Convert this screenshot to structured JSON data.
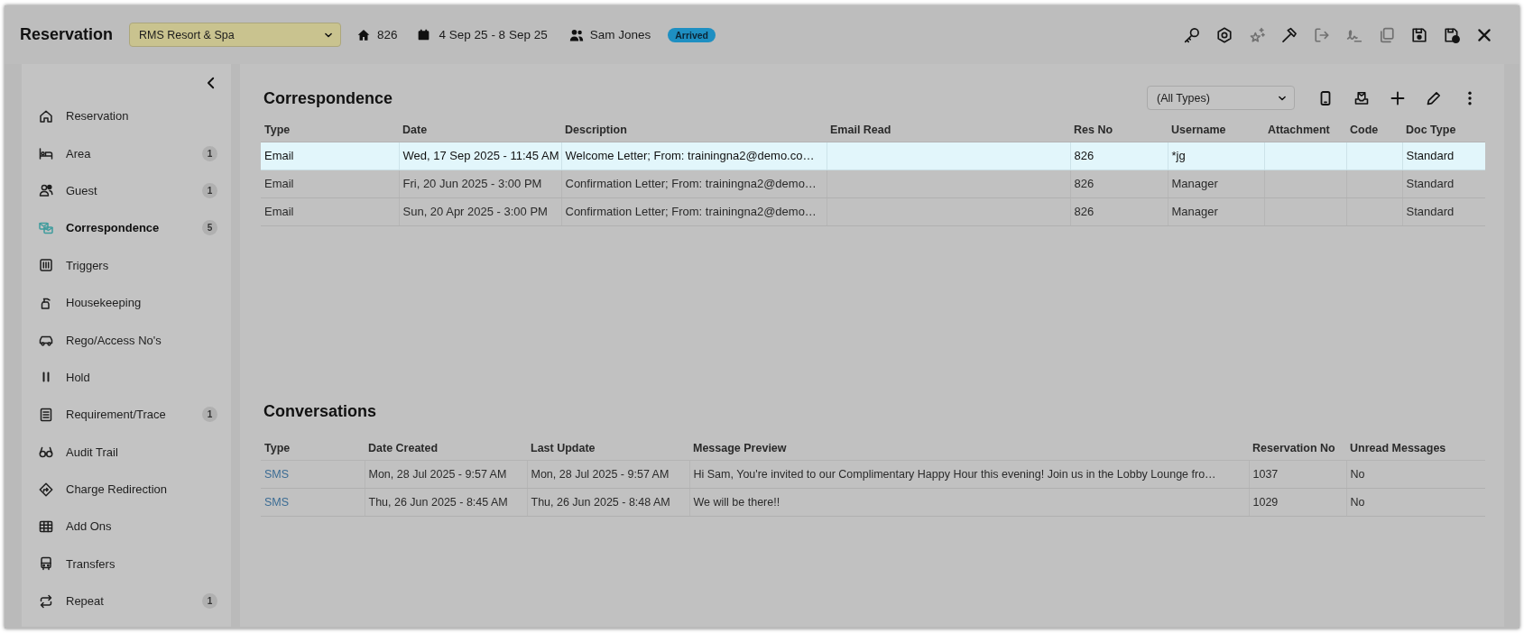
{
  "header": {
    "title": "Reservation",
    "property_select": {
      "value": "RMS Resort & Spa"
    },
    "room": "826",
    "dates": "4 Sep 25 - 8 Sep 25",
    "guest": "Sam Jones",
    "status_badge": "Arrived",
    "toolbar": [
      {
        "kind": "key",
        "disabled": false
      },
      {
        "kind": "gear",
        "disabled": false
      },
      {
        "kind": "sparkle",
        "disabled": true
      },
      {
        "kind": "hammer",
        "disabled": false
      },
      {
        "kind": "exit",
        "disabled": true
      },
      {
        "kind": "signature",
        "disabled": true
      },
      {
        "kind": "copy",
        "disabled": true
      },
      {
        "kind": "save",
        "disabled": false
      },
      {
        "kind": "save_status",
        "disabled": false
      },
      {
        "kind": "close",
        "disabled": false
      }
    ]
  },
  "sidebar": {
    "items": [
      {
        "kind": "home",
        "label": "Reservation",
        "selected": false
      },
      {
        "kind": "bed",
        "label": "Area",
        "count": "1",
        "selected": false
      },
      {
        "kind": "users",
        "label": "Guest",
        "count": "1",
        "selected": false
      },
      {
        "kind": "envelopes",
        "label": "Correspondence",
        "count": "5",
        "selected": true
      },
      {
        "kind": "columns",
        "label": "Triggers",
        "selected": false
      },
      {
        "kind": "spray",
        "label": "Housekeeping",
        "selected": false
      },
      {
        "kind": "car",
        "label": "Rego/Access No's",
        "selected": false
      },
      {
        "kind": "pause",
        "label": "Hold",
        "selected": false
      },
      {
        "kind": "list",
        "label": "Requirement/Trace",
        "count": "1",
        "selected": false
      },
      {
        "kind": "glasses",
        "label": "Audit Trail",
        "selected": false
      },
      {
        "kind": "direction",
        "label": "Charge Redirection",
        "selected": false
      },
      {
        "kind": "grid",
        "label": "Add Ons",
        "selected": false
      },
      {
        "kind": "bus",
        "label": "Transfers",
        "selected": false
      },
      {
        "kind": "repeat",
        "label": "Repeat",
        "count": "1",
        "selected": false
      }
    ]
  },
  "correspondence": {
    "title": "Correspondence",
    "type_filter": {
      "value": "(All Types)"
    },
    "table": {
      "columns": [
        "Type",
        "Date",
        "Description",
        "Email Read",
        "Res No",
        "Username",
        "Attachment",
        "Code",
        "Doc Type"
      ],
      "rows": [
        {
          "selected": true,
          "type": "Email",
          "date": "Wed, 17 Sep 2025 - 11:45 AM",
          "description": "Welcome Letter; From: trainingna2@demo.co…",
          "res_no": "826",
          "username": "*jg",
          "doc_type": "Standard"
        },
        {
          "selected": false,
          "type": "Email",
          "date": "Fri, 20 Jun 2025 - 3:00 PM",
          "description": "Confirmation Letter; From: trainingna2@demo…",
          "res_no": "826",
          "username": "Manager",
          "doc_type": "Standard"
        },
        {
          "selected": false,
          "type": "Email",
          "date": "Sun, 20 Apr 2025 - 3:00 PM",
          "description": "Confirmation Letter; From: trainingna2@demo…",
          "res_no": "826",
          "username": "Manager",
          "doc_type": "Standard"
        }
      ]
    }
  },
  "conversations": {
    "title": "Conversations",
    "table": {
      "columns": [
        "Type",
        "Date Created",
        "Last Update",
        "Message Preview",
        "Reservation No",
        "Unread Messages"
      ],
      "rows": [
        {
          "selected": false,
          "type": "SMS",
          "date_created": "Mon, 28 Jul 2025 - 9:57 AM",
          "last_update": "Mon, 28 Jul 2025 - 9:57 AM",
          "message_preview": "Hi Sam, You're invited to our Complimentary Happy Hour this evening! Join us in the Lobby Lounge fro…",
          "reservation_no": "1037",
          "unread_messages": "No"
        },
        {
          "selected": false,
          "type": "SMS",
          "date_created": "Thu, 26 Jun 2025 - 8:45 AM",
          "last_update": "Thu, 26 Jun 2025 - 8:48 AM",
          "message_preview": "We will be there!!",
          "reservation_no": "1029",
          "unread_messages": "No"
        }
      ]
    }
  }
}
